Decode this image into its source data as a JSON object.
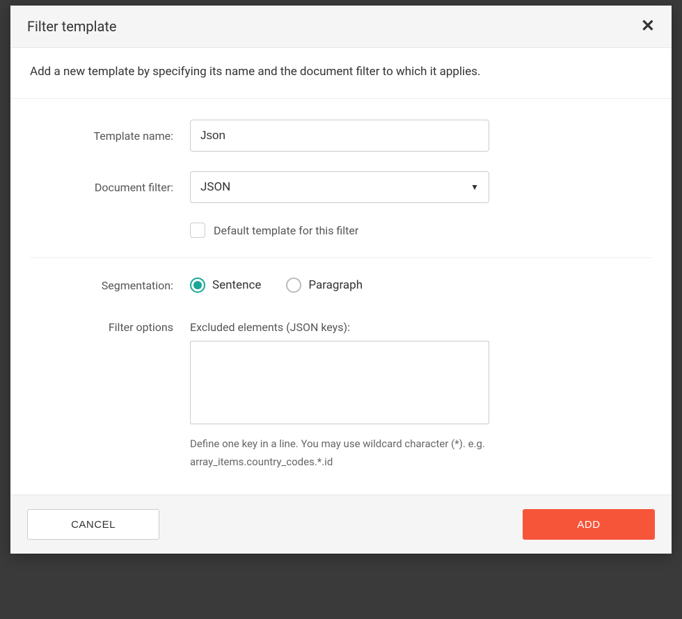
{
  "modal": {
    "title": "Filter template",
    "description": "Add a new template by specifying its name and the document filter to which it applies."
  },
  "form": {
    "templateName": {
      "label": "Template name:",
      "value": "Json"
    },
    "documentFilter": {
      "label": "Document filter:",
      "value": "JSON"
    },
    "defaultTemplate": {
      "label": "Default template for this filter"
    },
    "segmentation": {
      "label": "Segmentation:",
      "options": {
        "sentence": "Sentence",
        "paragraph": "Paragraph"
      }
    },
    "filterOptions": {
      "label": "Filter options",
      "excludedLabel": "Excluded elements (JSON keys):",
      "helpText": "Define one key in a line. You may use wildcard character (*). e.g. array_items.country_codes.*.id"
    }
  },
  "footer": {
    "cancel": "CANCEL",
    "add": "ADD"
  }
}
